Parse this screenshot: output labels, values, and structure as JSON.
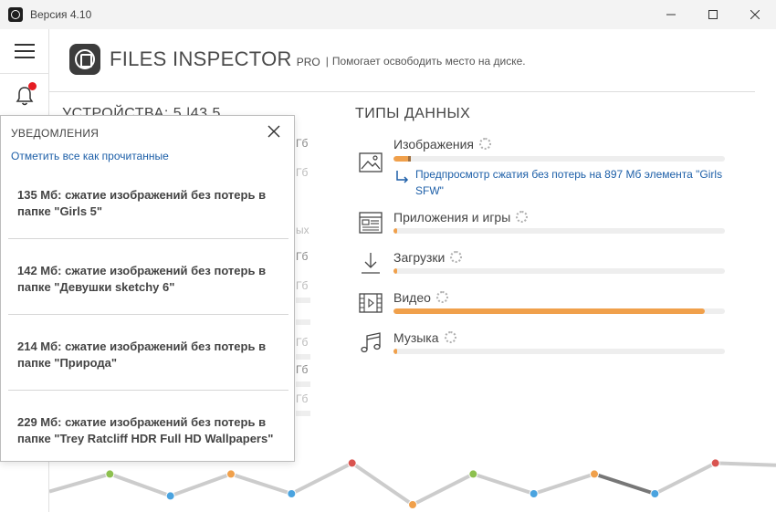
{
  "window": {
    "title": "Версия 4.10",
    "icons": [
      "minimize-icon",
      "maximize-icon",
      "close-icon"
    ]
  },
  "rail": {
    "icons": [
      "hamburger-menu-icon",
      "bell-icon"
    ],
    "notification_dot_color": "#e51c23"
  },
  "header": {
    "brand": "FILES INSPECTOR",
    "pro": "PRO",
    "separator": "|",
    "tagline": "Помогает освободить место на диске."
  },
  "devices": {
    "title": "УСТРОЙСТВА: 5 |43.5",
    "fragments": [
      "Гб",
      "Гб",
      "ых",
      "Гб",
      "Гб",
      "Гб",
      "Гб",
      "Гб"
    ]
  },
  "data_types": {
    "title": "ТИПЫ ДАННЫХ",
    "accent_color": "#f0a04b",
    "items": [
      {
        "label": "Изображения",
        "icon": "image-icon",
        "fill_fraction": 0.05
      },
      {
        "label": "Приложения и игры",
        "icon": "apps-icon",
        "fill_fraction": 0.01
      },
      {
        "label": "Загрузки",
        "icon": "download-icon",
        "fill_fraction": 0.01
      },
      {
        "label": "Видео",
        "icon": "video-icon",
        "fill_fraction": 0.94
      },
      {
        "label": "Музыка",
        "icon": "music-icon",
        "fill_fraction": 0.01
      }
    ],
    "preview_link": "Предпросмотр сжатия без потерь на 897 Мб элемента \"Girls SFW\""
  },
  "notifications": {
    "title": "УВЕДОМЛЕНИЯ",
    "mark_all": "Отметить все как прочитанные",
    "items": [
      "135 Мб: сжатие изображений без потерь в папке \"Girls 5\"",
      "142 Мб: сжатие изображений без потерь в папке \"Девушки sketchy 6\"",
      "214 Мб: сжатие изображений без потерь в папке \"Природа\"",
      "229 Мб: сжатие изображений без потерь в папке \"Trey Ratcliff HDR Full HD Wallpapers\""
    ]
  },
  "timeline": {
    "colors": {
      "green": "#8dc04f",
      "blue": "#4aa3df",
      "orange": "#f0a04b",
      "red": "#d9534f",
      "line": "#cccccc",
      "dark_line": "#777777"
    },
    "points": [
      {
        "v": 0.3,
        "c": "none"
      },
      {
        "v": 0.7,
        "c": "green"
      },
      {
        "v": 0.2,
        "c": "blue"
      },
      {
        "v": 0.7,
        "c": "orange"
      },
      {
        "v": 0.25,
        "c": "blue"
      },
      {
        "v": 0.95,
        "c": "red"
      },
      {
        "v": 0.0,
        "c": "orange"
      },
      {
        "v": 0.7,
        "c": "green"
      },
      {
        "v": 0.25,
        "c": "blue"
      },
      {
        "v": 0.7,
        "c": "orange"
      },
      {
        "v": 0.25,
        "c": "blue"
      },
      {
        "v": 0.95,
        "c": "red"
      },
      {
        "v": 0.9,
        "c": "none"
      }
    ]
  }
}
